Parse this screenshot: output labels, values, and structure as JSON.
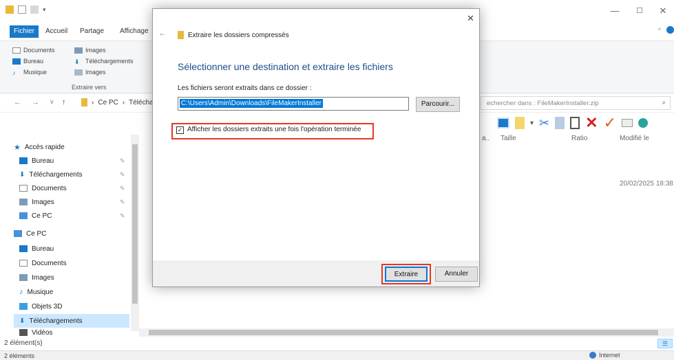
{
  "explorer": {
    "tabs": {
      "file": "Fichier",
      "home": "Accueil",
      "share": "Partage",
      "view": "Affichage"
    },
    "ribbon": {
      "col1": [
        "Documents",
        "Bureau",
        "Musique"
      ],
      "col2": [
        "Images",
        "Téléchargements",
        "Images"
      ],
      "group_label": "Extraire vers"
    },
    "address": {
      "ce_pc": "Ce PC",
      "segment": "Télécharg"
    },
    "search_placeholder": "echercher dans : FileMakerInstaller.zip",
    "nav": {
      "quick_access": "Accès rapide",
      "quick_items": [
        "Bureau",
        "Téléchargements",
        "Documents",
        "Images",
        "Ce PC"
      ],
      "this_pc": "Ce PC",
      "pc_items": [
        "Bureau",
        "Documents",
        "Images",
        "Musique",
        "Objets 3D",
        "Téléchargements",
        "Vidéos"
      ]
    },
    "columns": {
      "type_trunc": "a..",
      "size": "Taille",
      "ratio": "Ratio",
      "modified": "Modifié le"
    },
    "row_date": "20/02/2025 18:38",
    "status_items": "2 élément(s)",
    "status_items2": "2 éléments",
    "status_zone": "Internet",
    "colors": {
      "accent": "#1979ca",
      "selection": "#cce8ff"
    }
  },
  "dialog": {
    "window_title": "Extraire les dossiers compressés",
    "heading": "Sélectionner une destination et extraire les fichiers",
    "path_label": "Les fichiers seront extraits dans ce dossier :",
    "path_value": "C:\\Users\\Admin\\Downloads\\FileMakerInstaller",
    "browse_button": "Parcourir...",
    "checkbox_label": "Afficher les dossiers extraits une fois l'opération terminée",
    "checkbox_checked": true,
    "extract_button": "Extraire",
    "cancel_button": "Annuler",
    "colors": {
      "heading": "#1a4d8c",
      "highlight": "#e8361f",
      "primary": "#0078d7"
    }
  }
}
